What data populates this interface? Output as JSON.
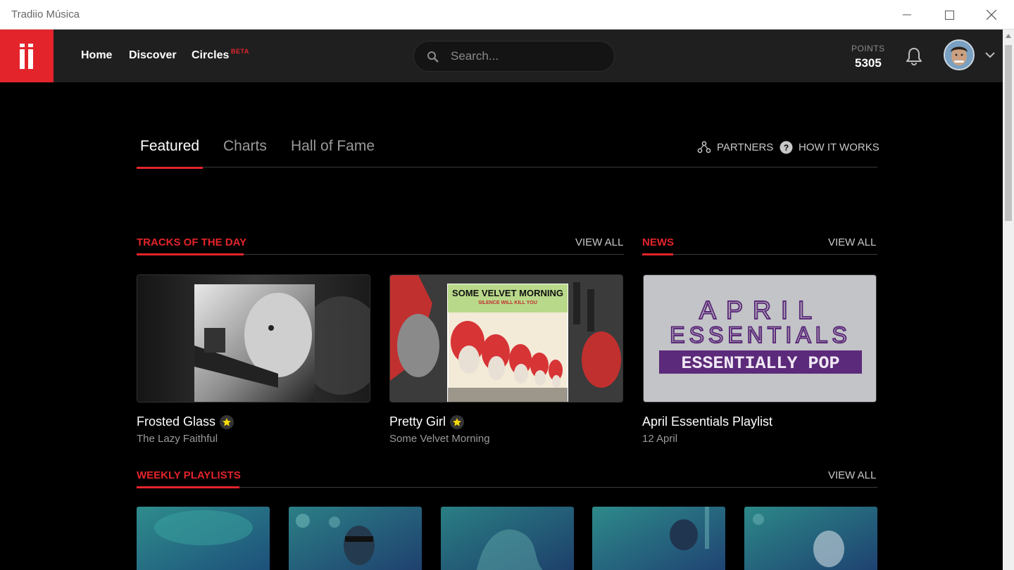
{
  "window": {
    "title": "Tradiio Música"
  },
  "nav": {
    "home": "Home",
    "discover": "Discover",
    "circles": "Circles",
    "beta": "BETA"
  },
  "search": {
    "placeholder": "Search..."
  },
  "points": {
    "label": "POINTS",
    "value": "5305"
  },
  "tabs": {
    "featured": "Featured",
    "charts": "Charts",
    "hall_of_fame": "Hall of Fame"
  },
  "links": {
    "partners": "PARTNERS",
    "how_it_works": "HOW IT WORKS"
  },
  "tracks": {
    "title": "TRACKS OF THE DAY",
    "view_all": "VIEW ALL",
    "items": [
      {
        "title": "Frosted Glass",
        "artist": "The Lazy Faithful"
      },
      {
        "title": "Pretty Girl",
        "artist": "Some Velvet Morning",
        "cover_line1": "SOME VELVET MORNING",
        "cover_line2": "SILENCE WILL KILL YOU"
      }
    ]
  },
  "news": {
    "title": "NEWS",
    "view_all": "VIEW ALL",
    "item": {
      "title": "April Essentials Playlist",
      "date": "12 April",
      "art_line1": "APRIL",
      "art_line2": "ESSENTIALS",
      "art_line3": "ESSENTIALLY POP"
    }
  },
  "weekly": {
    "title": "WEEKLY PLAYLISTS",
    "view_all": "VIEW ALL"
  },
  "colors": {
    "accent": "#e3242b",
    "header_bg": "#1f1f1f",
    "bg": "#000000"
  }
}
